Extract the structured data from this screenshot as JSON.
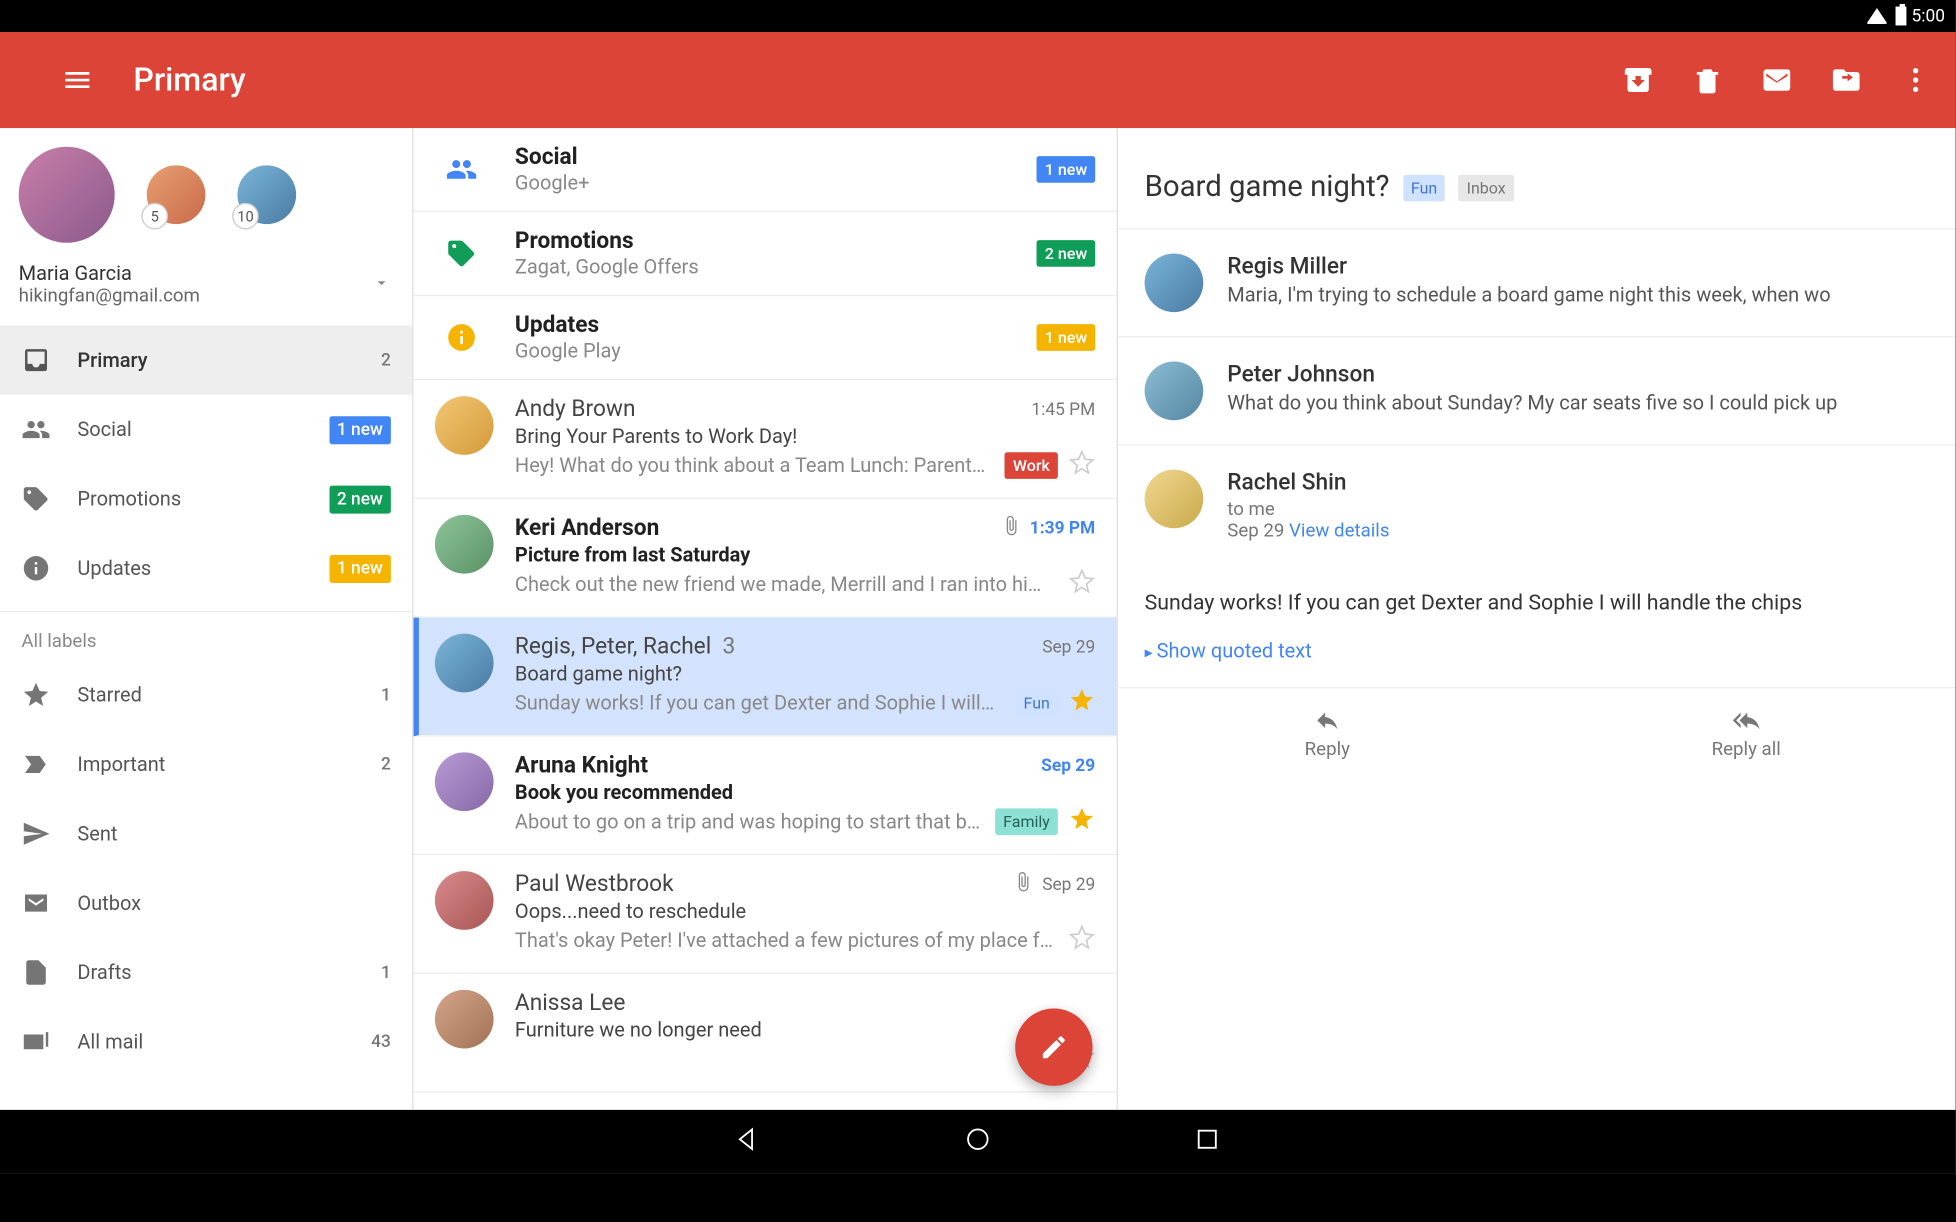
{
  "statusbar": {
    "time": "5:00"
  },
  "appbar": {
    "title": "Primary"
  },
  "account": {
    "name": "Maria Garcia",
    "email": "hikingfan@gmail.com",
    "alt1_count": "5",
    "alt2_count": "10"
  },
  "sidebar": {
    "primary": {
      "label": "Primary",
      "count": "2"
    },
    "social": {
      "label": "Social",
      "badge": "1 new"
    },
    "promotions": {
      "label": "Promotions",
      "badge": "2 new"
    },
    "updates": {
      "label": "Updates",
      "badge": "1 new"
    },
    "section_all": "All labels",
    "starred": {
      "label": "Starred",
      "count": "1"
    },
    "important": {
      "label": "Important",
      "count": "2"
    },
    "sent": {
      "label": "Sent"
    },
    "outbox": {
      "label": "Outbox"
    },
    "drafts": {
      "label": "Drafts",
      "count": "1"
    },
    "allmail": {
      "label": "All mail",
      "count": "43"
    }
  },
  "categories": {
    "social": {
      "name": "Social",
      "sub": "Google+",
      "badge": "1 new"
    },
    "promotions": {
      "name": "Promotions",
      "sub": "Zagat, Google Offers",
      "badge": "2 new"
    },
    "updates": {
      "name": "Updates",
      "sub": "Google Play",
      "badge": "1 new"
    }
  },
  "threads": [
    {
      "from": "Andy Brown",
      "date": "1:45 PM",
      "unread": false,
      "subject": "Bring Your Parents to Work Day!",
      "snippet": "Hey! What do you think about a Team Lunch: Parent…",
      "label": "Work",
      "label_cls": "b-red",
      "starred": false,
      "attach": false
    },
    {
      "from": "Keri Anderson",
      "date": "1:39 PM",
      "unread": true,
      "subject": "Picture from last Saturday",
      "snippet": "Check out the new friend we made, Merrill and I ran into him…",
      "label": null,
      "starred": false,
      "attach": true
    },
    {
      "from": "Regis, Peter, Rachel",
      "count": "3",
      "date": "Sep 29",
      "unread": false,
      "selected": true,
      "subject": "Board game night?",
      "snippet": "Sunday works! If you can get Dexter and Sophie I will…",
      "label": "Fun",
      "label_cls": "b-lblue",
      "starred": true,
      "attach": false
    },
    {
      "from": "Aruna Knight",
      "date": "Sep 29",
      "unread": true,
      "subject": "Book you recommended",
      "snippet": "About to go on a trip and was hoping to start that b…",
      "label": "Family",
      "label_cls": "b-teal",
      "starred": true,
      "attach": false
    },
    {
      "from": "Paul Westbrook",
      "date": "Sep 29",
      "unread": false,
      "subject": "Oops...need to reschedule",
      "snippet": "That's okay Peter! I've attached a few pictures of my place f…",
      "label": null,
      "starred": false,
      "attach": true
    },
    {
      "from": "Anissa Lee",
      "date": "",
      "unread": false,
      "subject": "Furniture we no longer need",
      "snippet": "",
      "label": null,
      "starred": false,
      "attach": false
    }
  ],
  "reader": {
    "title": "Board game night?",
    "tags": [
      "Fun",
      "Inbox"
    ],
    "messages": [
      {
        "from": "Regis Miller",
        "snippet": "Maria, I'm trying to schedule a board game night this week, when wo",
        "expanded": false
      },
      {
        "from": "Peter Johnson",
        "snippet": "What do you think about Sunday? My car seats five so I could pick up",
        "expanded": false
      },
      {
        "from": "Rachel Shin",
        "to": "to me",
        "date": "Sep 29",
        "details": "View details",
        "expanded": true
      }
    ],
    "body": "Sunday works! If you can get Dexter and Sophie I will handle the chips",
    "quoted": "Show quoted text",
    "reply": "Reply",
    "reply_all": "Reply all"
  }
}
